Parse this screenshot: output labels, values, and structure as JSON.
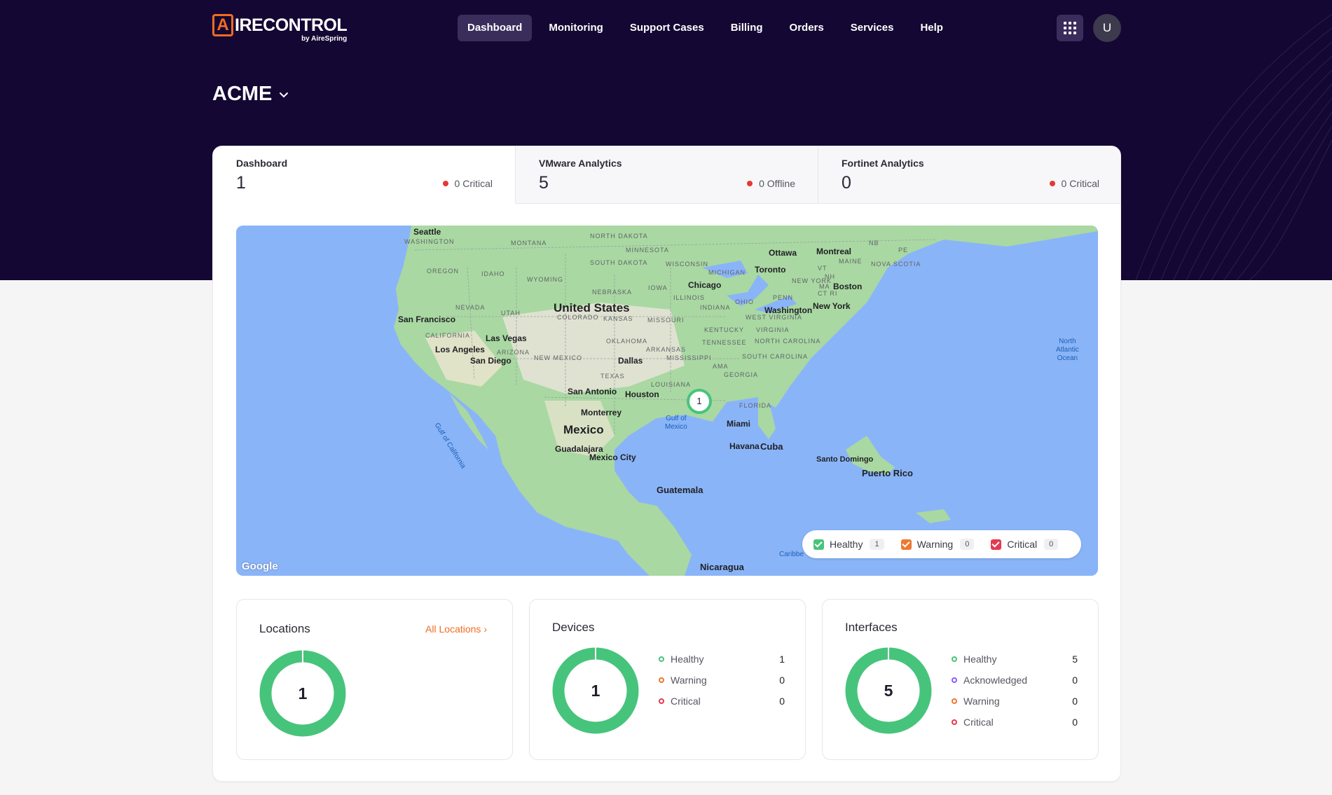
{
  "brand": {
    "logo_mark": "A",
    "logo_text": "IRECONTROL",
    "logo_sub": "by AireSpring",
    "accent": "#f26b21"
  },
  "nav": {
    "items": [
      "Dashboard",
      "Monitoring",
      "Support Cases",
      "Billing",
      "Orders",
      "Services",
      "Help"
    ],
    "active": "Dashboard"
  },
  "user": {
    "avatar_initial": "U"
  },
  "org": {
    "name": "ACME"
  },
  "tabs": [
    {
      "label": "Dashboard",
      "count": "1",
      "status": "0 Critical"
    },
    {
      "label": "VMware Analytics",
      "count": "5",
      "status": "0 Offline"
    },
    {
      "label": "Fortinet Analytics",
      "count": "0",
      "status": "0 Critical"
    }
  ],
  "map": {
    "cluster_count": "1",
    "attribution": "Google",
    "legend": [
      {
        "label": "Healthy",
        "count": "1",
        "color": "#47c47b"
      },
      {
        "label": "Warning",
        "count": "0",
        "color": "#f0772f"
      },
      {
        "label": "Critical",
        "count": "0",
        "color": "#e53950"
      }
    ],
    "labels": {
      "united_states": "United States",
      "mexico": "Mexico",
      "cuba": "Cuba",
      "guatemala": "Guatemala",
      "nicaragua": "Nicaragua",
      "puerto_rico": "Puerto Rico",
      "seattle": "Seattle",
      "san_francisco": "San Francisco",
      "los_angeles": "Los Angeles",
      "san_diego": "San Diego",
      "las_vegas": "Las Vegas",
      "dallas": "Dallas",
      "houston": "Houston",
      "san_antonio": "San Antonio",
      "monterrey": "Monterrey",
      "guadalajara": "Guadalajara",
      "mexico_city": "Mexico City",
      "chicago": "Chicago",
      "toronto": "Toronto",
      "ottawa": "Ottawa",
      "montreal": "Montreal",
      "boston": "Boston",
      "new_york": "New York",
      "washington": "Washington",
      "miami": "Miami",
      "havana": "Havana",
      "santo_domingo": "Santo Domingo",
      "washington_state": "WASHINGTON",
      "oregon": "OREGON",
      "idaho": "IDAHO",
      "montana": "MONTANA",
      "north_dakota": "NORTH DAKOTA",
      "south_dakota": "SOUTH DAKOTA",
      "minnesota": "MINNESOTA",
      "wyoming": "WYOMING",
      "nebraska": "NEBRASKA",
      "iowa": "IOWA",
      "nevada": "NEVADA",
      "utah": "UTAH",
      "colorado": "COLORADO",
      "kansas": "KANSAS",
      "missouri": "MISSOURI",
      "california": "CALIFORNIA",
      "arizona": "ARIZONA",
      "new_mexico": "NEW MEXICO",
      "oklahoma": "OKLAHOMA",
      "arkansas": "ARKANSAS",
      "texas": "TEXAS",
      "louisiana": "LOUISIANA",
      "mississippi": "MISSISSIPPI",
      "alabama": "AMA",
      "georgia": "GEORGIA",
      "florida": "FLORIDA",
      "tennessee": "TENNESSEE",
      "kentucky": "KENTUCKY",
      "illinois": "ILLINOIS",
      "indiana": "INDIANA",
      "ohio": "OHIO",
      "michigan": "MICHIGAN",
      "wisconsin": "WISCONSIN",
      "west_virginia": "WEST VIRGINIA",
      "virginia": "VIRGINIA",
      "north_carolina": "NORTH CAROLINA",
      "south_carolina": "SOUTH CAROLINA",
      "penn": "PENN",
      "new_york_state": "NEW YORK",
      "maine": "MAINE",
      "vt": "VT",
      "nh": "NH",
      "ma": "MA",
      "ct_ri": "CT RI",
      "nb": "NB",
      "pe": "PE",
      "nova_scotia": "NOVA SCOTIA",
      "gulf_of_mexico": "Gulf of\nMexico",
      "gulf_of_california": "Gulf of California",
      "north_atlantic": "North\nAtlantic\nOcean",
      "caribbean": "Caribbe"
    }
  },
  "locations": {
    "title": "Locations",
    "link": "All Locations",
    "total": "1",
    "healthy_fraction": 1.0
  },
  "devices": {
    "title": "Devices",
    "total": "1",
    "stats": [
      {
        "label": "Healthy",
        "value": "1",
        "color": "#47c47b"
      },
      {
        "label": "Warning",
        "value": "0",
        "color": "#f0772f"
      },
      {
        "label": "Critical",
        "value": "0",
        "color": "#e53950"
      }
    ]
  },
  "interfaces": {
    "title": "Interfaces",
    "total": "5",
    "stats": [
      {
        "label": "Healthy",
        "value": "5",
        "color": "#47c47b"
      },
      {
        "label": "Acknowledged",
        "value": "0",
        "color": "#8b5cf6"
      },
      {
        "label": "Warning",
        "value": "0",
        "color": "#f0772f"
      },
      {
        "label": "Critical",
        "value": "0",
        "color": "#e53950"
      }
    ]
  }
}
